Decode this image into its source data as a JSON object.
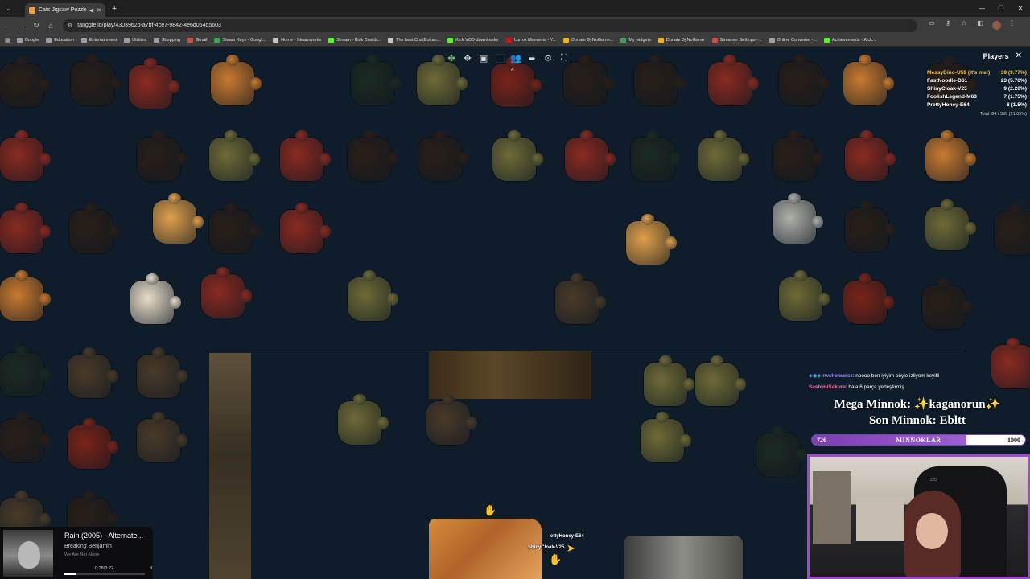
{
  "browser": {
    "tab_title": "Cats Jigsaw Puzzle",
    "url": "tanggle.io/play/4303962b-a7bf-4ce7-9842-4e6d064d5603",
    "bookmarks": [
      {
        "label": "Google",
        "color": "#9aa0a6"
      },
      {
        "label": "Education",
        "color": "#9aa0a6"
      },
      {
        "label": "Entertainment",
        "color": "#9aa0a6"
      },
      {
        "label": "Utilities",
        "color": "#9aa0a6"
      },
      {
        "label": "Shopping",
        "color": "#9aa0a6"
      },
      {
        "label": "Gmail",
        "color": "#ea4335"
      },
      {
        "label": "Steam Keys - Googl...",
        "color": "#34a853"
      },
      {
        "label": "Home - Steamworks",
        "color": "#c4c7c5"
      },
      {
        "label": "Stream - Kick Dashb...",
        "color": "#53fc18"
      },
      {
        "label": "The best ChatBot an...",
        "color": "#c4c7c5"
      },
      {
        "label": "Kick VOD downloader",
        "color": "#53fc18"
      },
      {
        "label": "Lurrox Moments - Y...",
        "color": "#ff0000"
      },
      {
        "label": "Donate ByNoGame...",
        "color": "#f4b400"
      },
      {
        "label": "My widgets",
        "color": "#34a853"
      },
      {
        "label": "Donate ByNoGame",
        "color": "#f4b400"
      },
      {
        "label": "Streamer Settings -...",
        "color": "#ea4335"
      },
      {
        "label": "Online Converter -...",
        "color": "#9aa0a6"
      },
      {
        "label": "Achievements - Kick...",
        "color": "#53fc18"
      }
    ]
  },
  "toolbar": {
    "icons": [
      "puzzle-piece-icon",
      "piece-shape-icon",
      "image-preview-icon",
      "background-color-icon",
      "players-icon",
      "share-icon",
      "settings-icon",
      "fullscreen-icon"
    ],
    "collapse_icon": "chevron-up-icon"
  },
  "players": {
    "title": "Players",
    "list": [
      {
        "name": "MessyDino-U59 (it's me!)",
        "score": "39 (9.77%)",
        "me": true
      },
      {
        "name": "FastNoodle-D61",
        "score": "23 (5.76%)",
        "me": false
      },
      {
        "name": "ShinyCloak-V25",
        "score": "9 (2.26%)",
        "me": false
      },
      {
        "name": "FoolishLegend-M63",
        "score": "7 (1.75%)",
        "me": false
      },
      {
        "name": "PrettyHoney-E64",
        "score": "6 (1.5%)",
        "me": false
      }
    ],
    "total": "Total: 84 / 399 (21.05%)"
  },
  "chat": {
    "line1_user": "rwchelweisz",
    "line1_text": ": noooo ben iyiyim böyle izliyom keyifli",
    "line2_user": "SashimiSakura",
    "line2_text": ": hala 6 parça yerleştirmiş"
  },
  "overlay": {
    "mega": "Mega Minnok: ✨kaganorun✨",
    "son": "Son Minnok: Ebltt",
    "goal_current": "726",
    "goal_label": "MINNOKLAR",
    "goal_max": "1000",
    "goal_fraction": 0.726,
    "accent": "#a347d1"
  },
  "music": {
    "title": "Rain (2005) - Alternate...",
    "artist": "Breaking Benjamin",
    "album": "We Are Not Alone",
    "time": "0:28/3:22",
    "progress_fraction": 0.14
  },
  "cursors": {
    "label1": "ettyHoney-E64",
    "label2": "ShinyCloak-V25"
  },
  "colors": {
    "background": "#0f1d2b",
    "me_highlight": "#f2c744"
  }
}
